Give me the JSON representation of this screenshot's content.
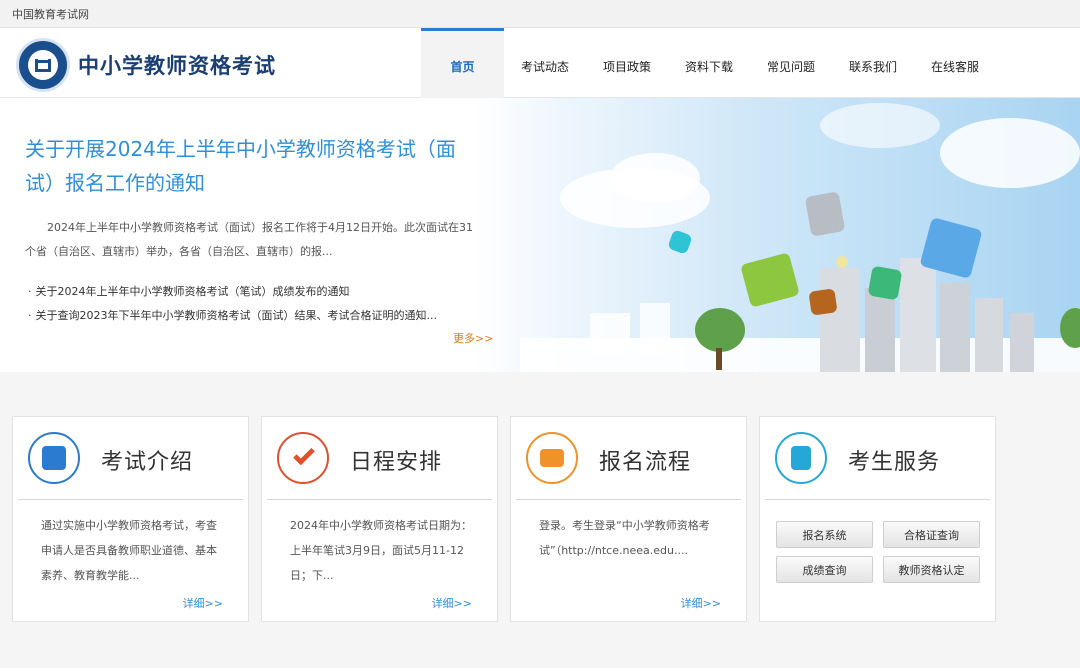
{
  "topbar": {
    "site_name": "中国教育考试网"
  },
  "header": {
    "brand": "中小学教师资格考试",
    "nav": [
      {
        "label": "首页",
        "active": true
      },
      {
        "label": "考试动态",
        "active": false
      },
      {
        "label": "项目政策",
        "active": false
      },
      {
        "label": "资料下载",
        "active": false
      },
      {
        "label": "常见问题",
        "active": false
      },
      {
        "label": "联系我们",
        "active": false
      },
      {
        "label": "在线客服",
        "active": false
      }
    ]
  },
  "banner": {
    "headline": "关于开展2024年上半年中小学教师资格考试（面试）报名工作的通知",
    "summary": "2024年上半年中小学教师资格考试（面试）报名工作将于4月12日开始。此次面试在31个省（自治区、直辖市）举办，各省（自治区、直辖市）的报...",
    "links": [
      "关于2024年上半年中小学教师资格考试（笔试）成绩发布的通知",
      "关于查询2023年下半年中小学教师资格考试（面试）结果、考试合格证明的通知..."
    ],
    "more": "更多>>"
  },
  "cards": [
    {
      "title": "考试介绍",
      "desc": "通过实施中小学教师资格考试，考查申请人是否具备教师职业道德、基本素养、教育教学能...",
      "detail": "详细>>",
      "icon": "document-edit-icon",
      "color": "#2b7bd0"
    },
    {
      "title": "日程安排",
      "desc": "2024年中小学教师资格考试日期为：上半年笔试3月9日，面试5月11-12日；下...",
      "detail": "详细>>",
      "icon": "checkmark-icon",
      "color": "#e0502b"
    },
    {
      "title": "报名流程",
      "desc": "登录。考生登录“中小学教师资格考试”（http://ntce.neea.edu....",
      "detail": "详细>>",
      "icon": "registration-form-icon",
      "color": "#f0922a"
    },
    {
      "title": "考生服务",
      "icon": "address-book-icon",
      "color": "#25a8d8",
      "buttons": [
        "报名系统",
        "合格证查询",
        "成绩查询",
        "教师资格认定"
      ]
    }
  ]
}
